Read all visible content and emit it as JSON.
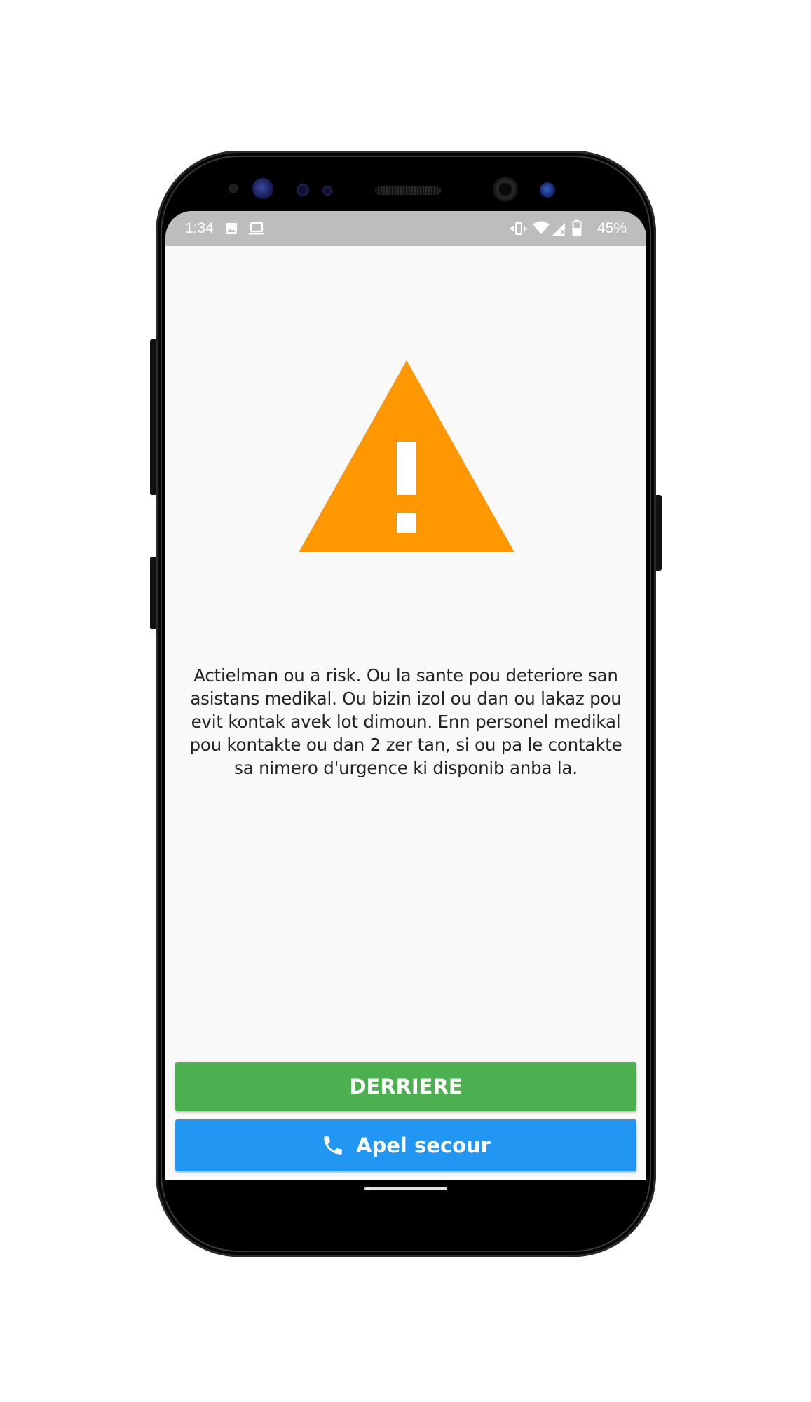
{
  "status_bar": {
    "time": "1:34",
    "battery_percent": "45%",
    "icons_left": [
      "image-icon",
      "laptop-icon"
    ],
    "icons_right": [
      "vibrate-icon",
      "wifi-icon",
      "signal-icon",
      "battery-icon"
    ]
  },
  "warning": {
    "icon": "warning-triangle-icon",
    "color": "#ff9800",
    "message": "Actielman ou a risk. Ou la sante pou deteriore san asistans medikal. Ou bizin izol ou dan ou lakaz pou evit kontak avek lot dimoun. Enn personel medikal pou kontakte ou dan 2 zer tan, si ou pa le contakte sa nimero d'urgence ki disponib anba la."
  },
  "buttons": {
    "back_label": "DERRIERE",
    "back_color": "#4caf50",
    "call_label": "Apel secour",
    "call_icon": "phone-icon",
    "call_color": "#2196f3"
  }
}
